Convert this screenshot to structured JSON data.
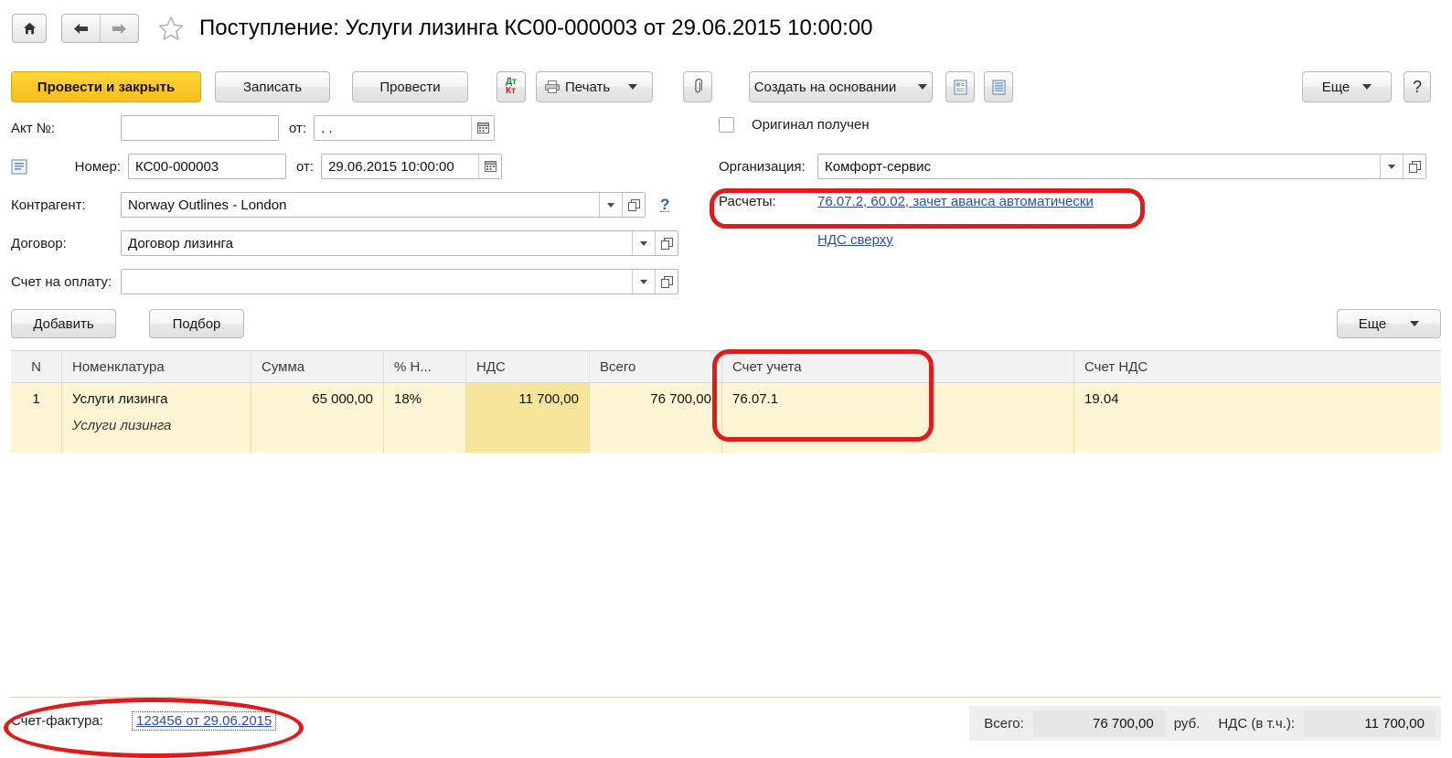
{
  "window": {
    "title": "Поступление: Услуги лизинга КС00-000003 от 29.06.2015 10:00:00",
    "home_icon": "home-icon",
    "back_icon": "back-arrow-icon",
    "forward_icon": "forward-arrow-icon",
    "favorite_icon": "star-icon"
  },
  "toolbar": {
    "post_and_close": "Провести и закрыть",
    "save": "Записать",
    "post": "Провести",
    "dtkt_dt": "Дт",
    "dtkt_kt": "Кт",
    "print": "Печать",
    "print_icon": "printer-icon",
    "attach_icon": "paperclip-icon",
    "create_based_on": "Создать на основании",
    "report_icon": "report-document-icon",
    "list_icon": "list-lines-icon",
    "more": "Еще",
    "help": "?"
  },
  "form": {
    "act_number_label": "Акт №:",
    "act_number_value": "",
    "act_date_label": "от:",
    "act_date_value": ". .",
    "doc_icon": "document-icon",
    "number_label": "Номер:",
    "number_value": "КС00-000003",
    "number_date_label": "от:",
    "number_date_value": "29.06.2015 10:00:00",
    "calendar_icon": "calendar-icon",
    "counterparty_label": "Контрагент:",
    "counterparty_value": "Norway Outlines - London",
    "contract_label": "Договор:",
    "contract_value": "Договор лизинга",
    "invoice_for_payment_label": "Счет на оплату:",
    "invoice_for_payment_value": "",
    "help_icon": "question-mark-icon",
    "open_icon": "open-form-icon",
    "original_received_label": "Оригинал получен",
    "original_received_checked": false,
    "organization_label": "Организация:",
    "organization_value": "Комфорт-сервис",
    "settlements_label": "Расчеты:",
    "settlements_link": "76.07.2, 60.02, зачет аванса автоматически",
    "vat_mode_link": "НДС сверху"
  },
  "table_toolbar": {
    "add": "Добавить",
    "select": "Подбор",
    "more": "Еще"
  },
  "table": {
    "columns": [
      {
        "key": "n",
        "label": "N"
      },
      {
        "key": "item",
        "label": "Номенклатура"
      },
      {
        "key": "amount",
        "label": "Сумма"
      },
      {
        "key": "vat_pct",
        "label": "% Н..."
      },
      {
        "key": "vat",
        "label": "НДС"
      },
      {
        "key": "total",
        "label": "Всего"
      },
      {
        "key": "account",
        "label": "Счет учета"
      },
      {
        "key": "vat_account",
        "label": "Счет НДС"
      }
    ],
    "rows": [
      {
        "n": "1",
        "item": "Услуги лизинга",
        "item_sub": "Услуги лизинга",
        "amount": "65 000,00",
        "vat_pct": "18%",
        "vat": "11 700,00",
        "total": "76 700,00",
        "account": "76.07.1",
        "vat_account": "19.04"
      }
    ]
  },
  "footer": {
    "invoice_label": "Счет-фактура:",
    "invoice_link": "123456 от 29.06.2015",
    "total_label": "Всего:",
    "total_value": "76 700,00",
    "currency": "руб.",
    "vat_label": "НДС (в т.ч.):",
    "vat_value": "11 700,00"
  },
  "colors": {
    "accent_yellow": "#fdc82c",
    "row_yellow": "#fdf5d3",
    "cell_highlight": "#f7e49b",
    "link_blue": "#2a4fa0",
    "annotation_red": "#e01b1b"
  }
}
